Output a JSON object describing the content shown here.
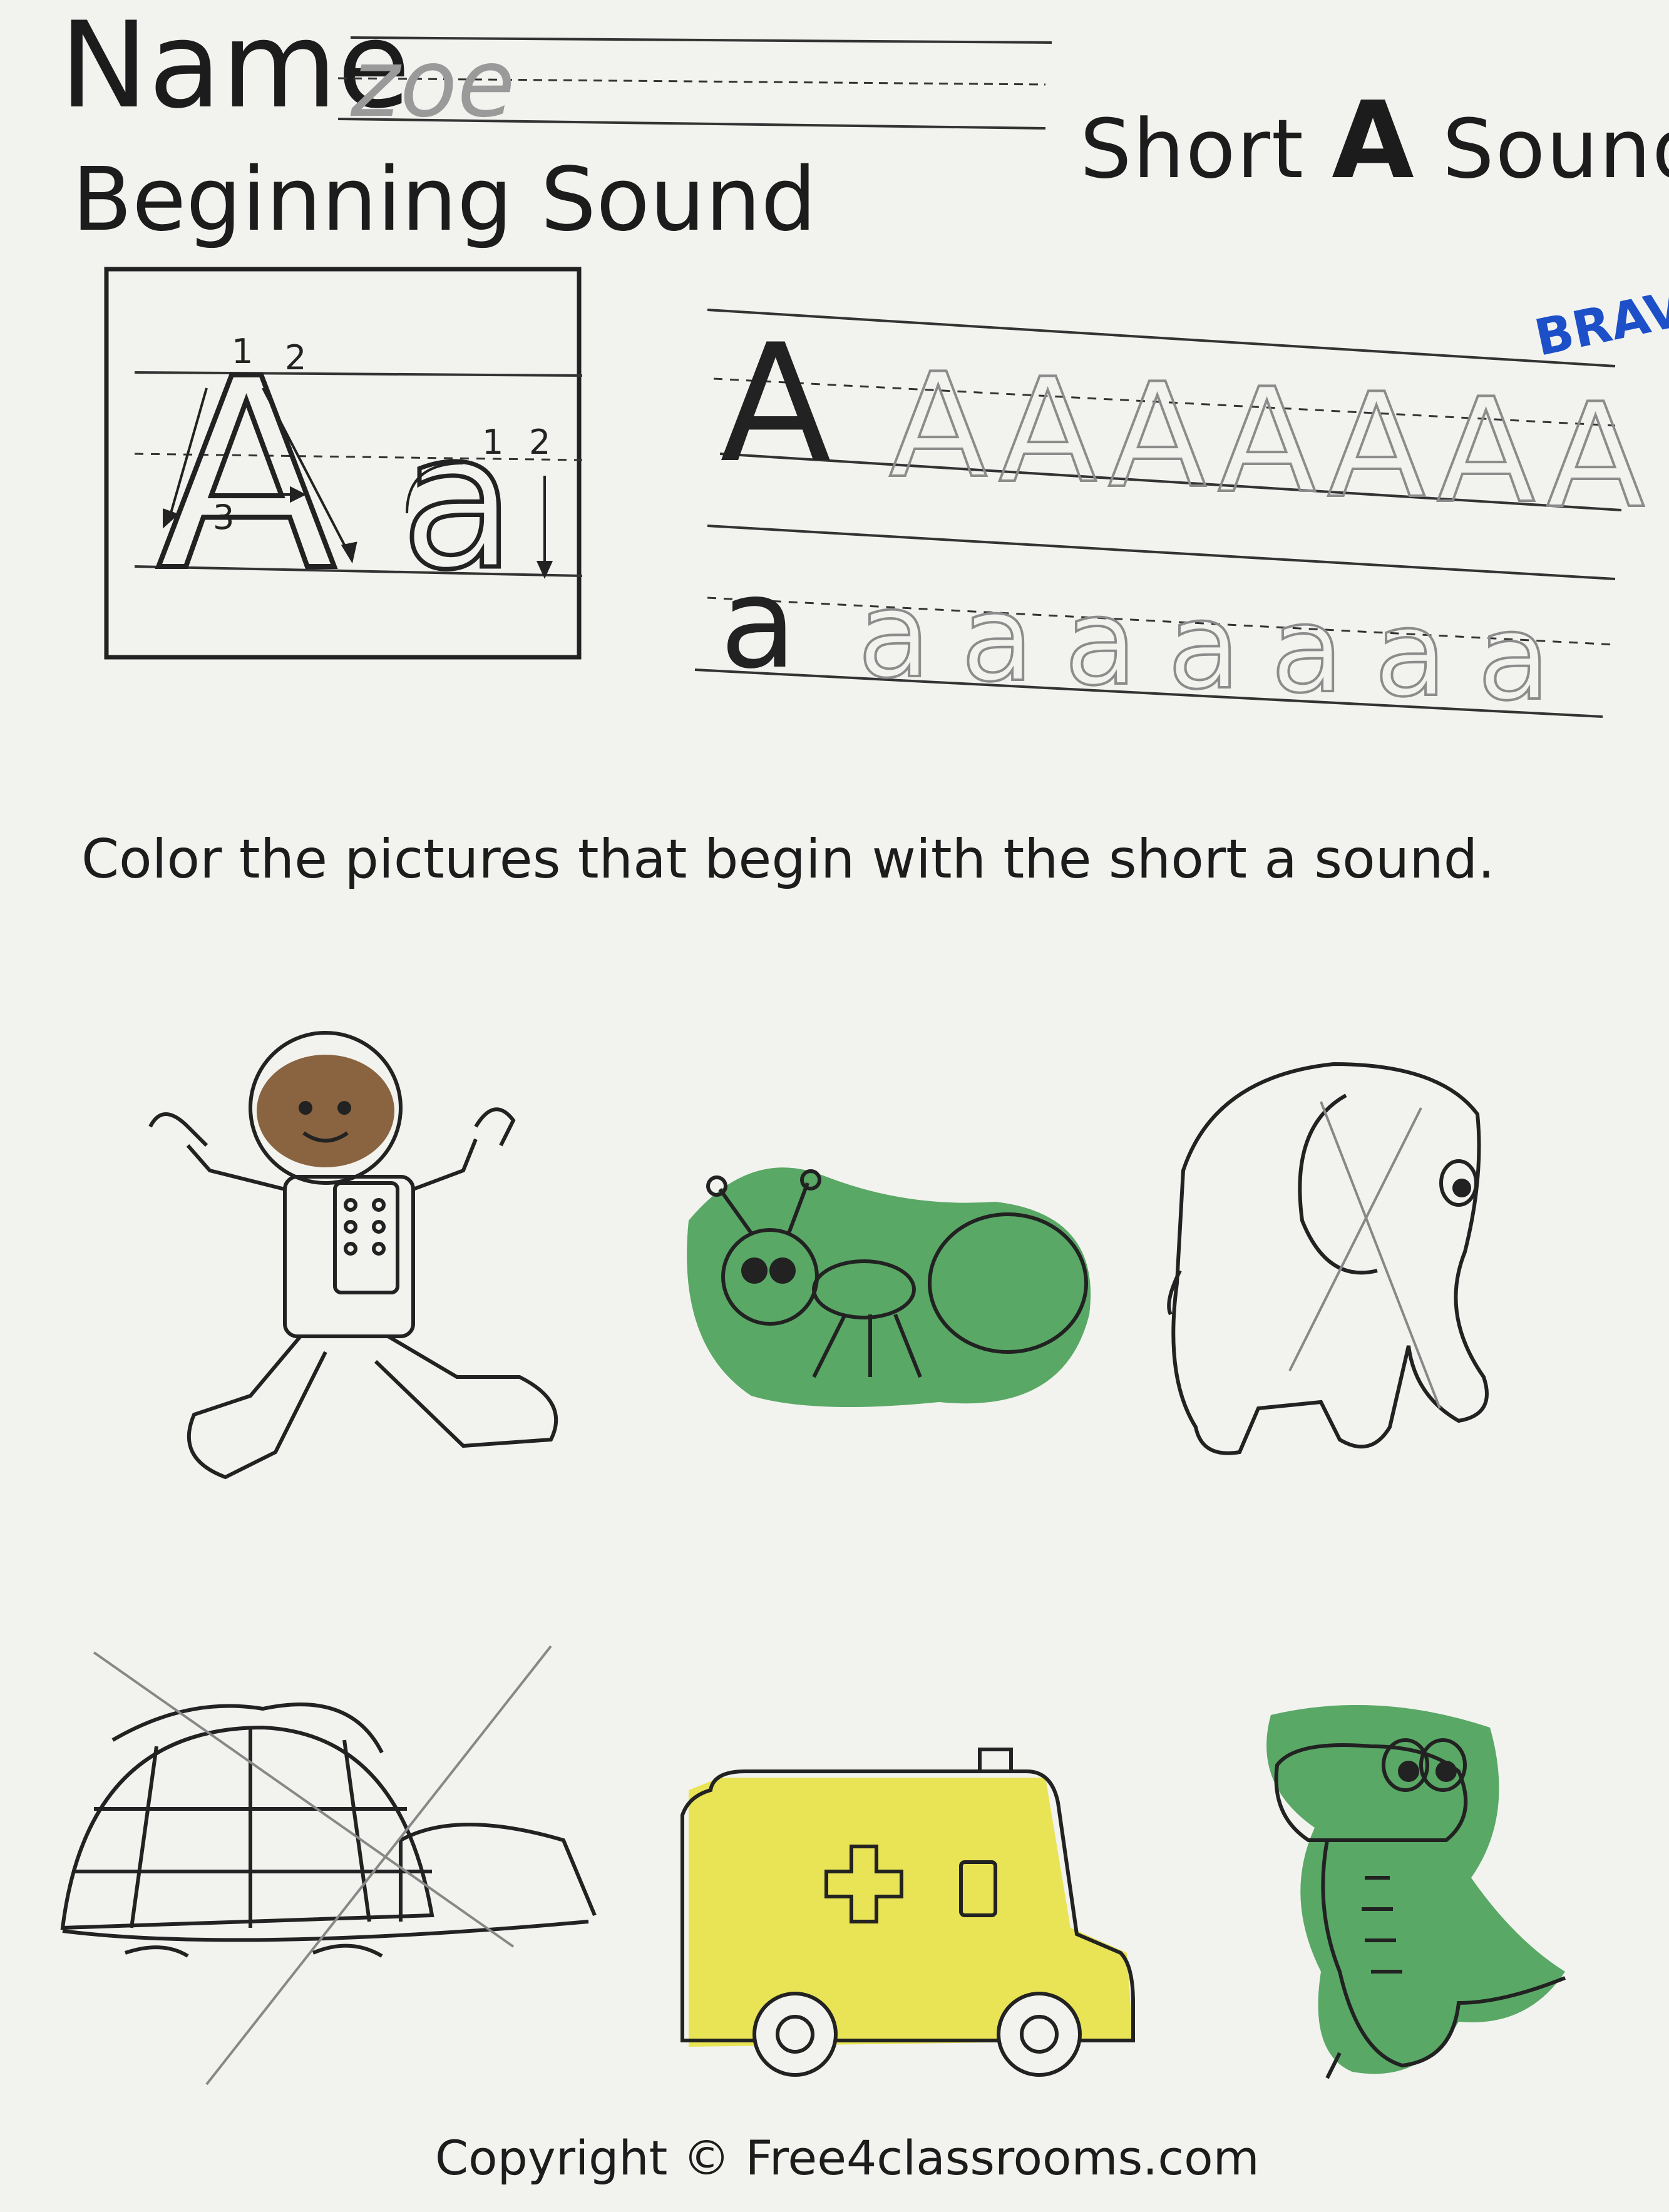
{
  "worksheet": {
    "name_label": "Name",
    "name_written": "zoe",
    "title_prefix": "Short",
    "title_letter": "A",
    "title_suffix": "Sound",
    "subtitle": "Beginning Sound",
    "instructions": "Color the pictures that begin with the short a sound.",
    "copyright": "Copyright © Free4classrooms.com",
    "stamp": "BRAVO"
  },
  "letter_box": {
    "uppercase": "A",
    "lowercase": "a",
    "stroke_numbers": [
      "1",
      "2",
      "3",
      "1",
      "2"
    ]
  },
  "tracing": {
    "upper_model": "A",
    "lower_model": "a",
    "upper_traced_count": 7,
    "lower_traced_count": 7
  },
  "pictures": [
    {
      "id": "astronaut",
      "colored": true,
      "crossed_out": false,
      "crayon_color": "#8a6440"
    },
    {
      "id": "ant",
      "colored": true,
      "crossed_out": false,
      "crayon_color": "#3f9a4e"
    },
    {
      "id": "elephant",
      "colored": false,
      "crossed_out": true,
      "crayon_color": ""
    },
    {
      "id": "igloo",
      "colored": false,
      "crossed_out": true,
      "crayon_color": ""
    },
    {
      "id": "ambulance",
      "colored": true,
      "crossed_out": false,
      "crayon_color": "#e8e13a"
    },
    {
      "id": "alligator",
      "colored": true,
      "crossed_out": false,
      "crayon_color": "#3f9a4e"
    }
  ],
  "colors": {
    "paper": "#f2f3ef",
    "ink": "#1c1c1c",
    "pencil": "#8c8c8c",
    "bravo": "#1d4fc9"
  }
}
